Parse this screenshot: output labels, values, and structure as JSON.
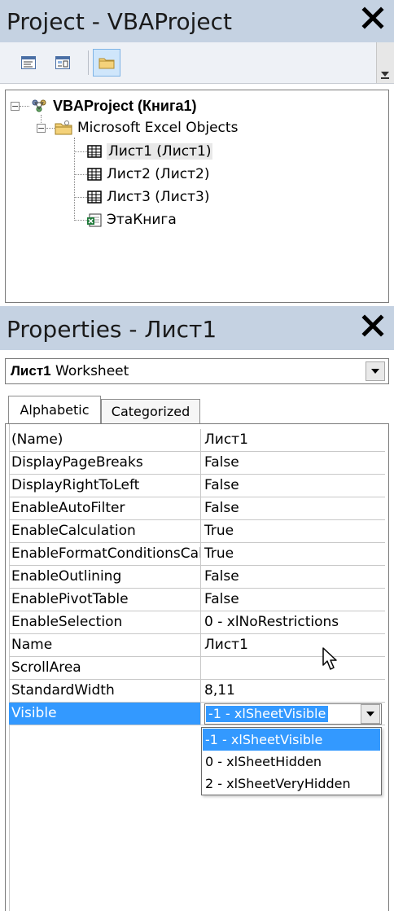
{
  "project_window": {
    "title": "Project - VBAProject",
    "close_glyph": "✕",
    "toolbar": [
      {
        "name": "view-code-button",
        "icon": "view-code-icon"
      },
      {
        "name": "view-object-button",
        "icon": "view-object-icon"
      },
      {
        "name": "toggle-folders-button",
        "icon": "folder-icon",
        "active": true
      }
    ],
    "tree": {
      "root": "VBAProject (Книга1)",
      "folder": "Microsoft Excel Objects",
      "items": [
        {
          "label": "Лист1 (Лист1)",
          "icon": "worksheet-icon",
          "selected": true
        },
        {
          "label": "Лист2 (Лист2)",
          "icon": "worksheet-icon"
        },
        {
          "label": "Лист3 (Лист3)",
          "icon": "worksheet-icon"
        },
        {
          "label": "ЭтаКнига",
          "icon": "workbook-icon"
        }
      ]
    }
  },
  "properties_window": {
    "title": "Properties - Лист1",
    "object_selector": {
      "name": "Лист1",
      "type": "Worksheet"
    },
    "tabs": [
      "Alphabetic",
      "Categorized"
    ],
    "active_tab": "Alphabetic",
    "rows": [
      {
        "name": "(Name)",
        "value": "Лист1"
      },
      {
        "name": "DisplayPageBreaks",
        "value": "False"
      },
      {
        "name": "DisplayRightToLeft",
        "value": "False"
      },
      {
        "name": "EnableAutoFilter",
        "value": "False"
      },
      {
        "name": "EnableCalculation",
        "value": "True"
      },
      {
        "name": "EnableFormatConditionsCalculation",
        "value": "True"
      },
      {
        "name": "EnableOutlining",
        "value": "False"
      },
      {
        "name": "EnablePivotTable",
        "value": "False"
      },
      {
        "name": "EnableSelection",
        "value": "0 - xlNoRestrictions"
      },
      {
        "name": "Name",
        "value": "Лист1"
      },
      {
        "name": "ScrollArea",
        "value": ""
      },
      {
        "name": "StandardWidth",
        "value": "8,11"
      },
      {
        "name": "Visible",
        "value": "-1 - xlSheetVisible"
      }
    ],
    "dropdown_options": [
      "-1 - xlSheetVisible",
      "0 - xlSheetHidden",
      "2 - xlSheetVeryHidden"
    ],
    "highlighted_option": "-1 - xlSheetVisible"
  },
  "colors": {
    "titlebar": "#c5d2e2",
    "selection": "#3399ff"
  }
}
